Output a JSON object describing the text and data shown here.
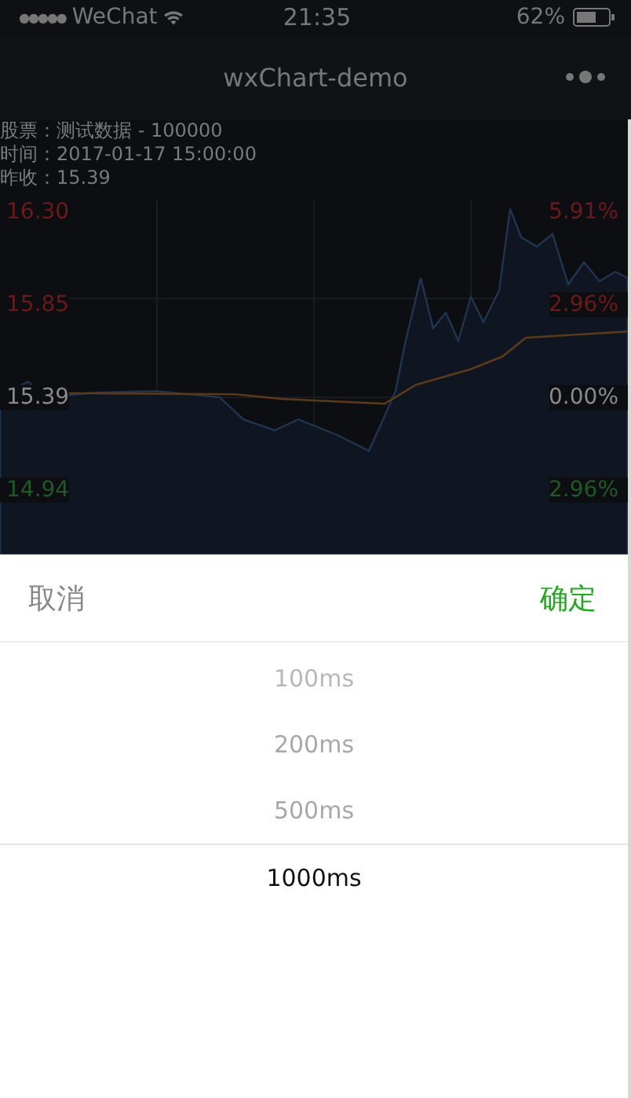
{
  "status_bar": {
    "signal": "●●●●●",
    "carrier": "WeChat",
    "time": "21:35",
    "battery": "62%"
  },
  "nav_bar": {
    "title": "wxChart-demo"
  },
  "info_lines": [
    "股票：测试数据 - 100000",
    "时间：2017-01-17 15:00:00",
    "昨收：15.39"
  ],
  "price_labels": [
    {
      "text": "16.30",
      "color": "#6b1a1a"
    },
    {
      "text": "15.85",
      "color": "#6b1a1a"
    },
    {
      "text": "15.39",
      "color": "#8a8a8a"
    },
    {
      "text": "14.94",
      "color": "#1f5a26"
    }
  ],
  "percent_labels": [
    {
      "text": "5.91%",
      "color": "#6b1a1a"
    },
    {
      "text": "2.96%",
      "color": "#6b1a1a"
    },
    {
      "text": "0.00%",
      "color": "#8a8a8a"
    },
    {
      "text": "2.96%",
      "color": "#1f5a26"
    }
  ],
  "picker": {
    "cancel": "取消",
    "confirm": "确定",
    "options": [
      {
        "label": "100ms",
        "selected": false
      },
      {
        "label": "200ms",
        "selected": false
      },
      {
        "label": "500ms",
        "selected": false
      },
      {
        "label": "1000ms",
        "selected": true
      }
    ]
  }
}
